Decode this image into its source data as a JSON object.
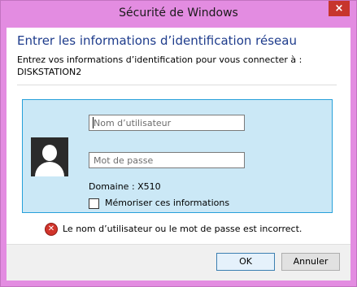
{
  "window": {
    "title": "Sécurité de Windows",
    "close_glyph": "×",
    "accent_color": "#e38ce1"
  },
  "dialog": {
    "heading": "Entrer les informations d’identification réseau",
    "prompt": "Entrez vos informations d’identification pour vous connecter à :",
    "server": "DISKSTATION2"
  },
  "credentials": {
    "avatar_icon": "user-silhouette-icon",
    "username_placeholder": "Nom d’utilisateur",
    "username_value": "",
    "password_placeholder": "Mot de passe",
    "password_value": "",
    "domain": "Domaine : X510",
    "remember_label": "Mémoriser ces informations",
    "remember_checked": false
  },
  "error": {
    "icon": "error-x-icon",
    "icon_glyph": "✕",
    "message": "Le nom d’utilisateur ou le mot de passe est incorrect."
  },
  "buttons": {
    "ok_label": "OK",
    "cancel_label": "Annuler"
  }
}
